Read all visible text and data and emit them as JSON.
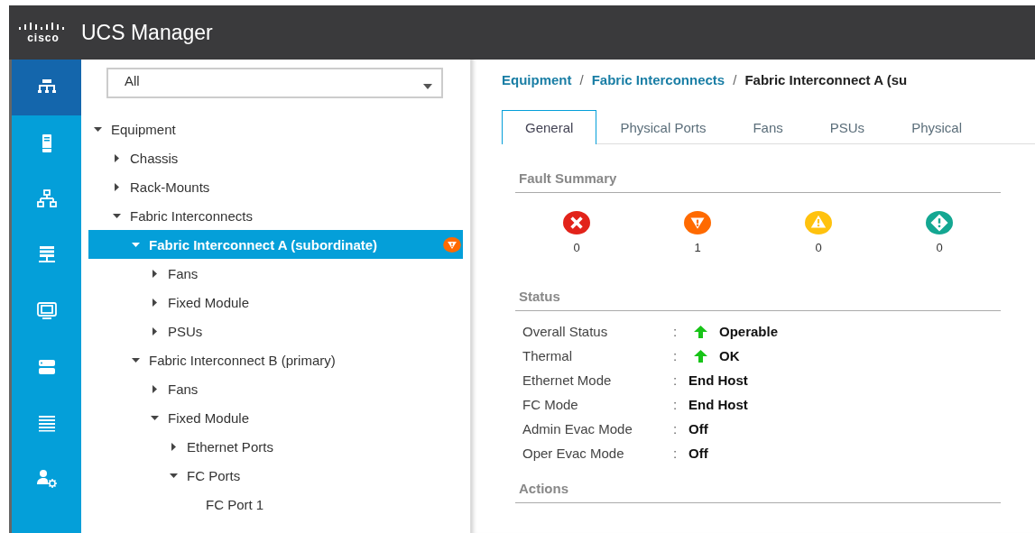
{
  "header": {
    "logo": "cisco",
    "title": "UCS Manager"
  },
  "nav": [
    {
      "kind": "hierarchy",
      "selected": true
    },
    {
      "kind": "server",
      "selected": false
    },
    {
      "kind": "network",
      "selected": false
    },
    {
      "kind": "stack",
      "selected": false
    },
    {
      "kind": "monitor",
      "selected": false
    },
    {
      "kind": "storage",
      "selected": false
    },
    {
      "kind": "list",
      "selected": false
    },
    {
      "kind": "admin",
      "selected": false
    }
  ],
  "filter": {
    "value": "All"
  },
  "tree": [
    {
      "label": "Equipment",
      "expanded": true,
      "selected": false,
      "children": [
        {
          "label": "Chassis",
          "expanded": false,
          "selected": false
        },
        {
          "label": "Rack-Mounts",
          "expanded": false,
          "selected": false
        },
        {
          "label": "Fabric Interconnects",
          "expanded": true,
          "selected": false,
          "children": [
            {
              "label": "Fabric Interconnect A (subordinate)",
              "expanded": true,
              "selected": true,
              "fault": {
                "kind": "major"
              },
              "children": [
                {
                  "label": "Fans",
                  "expanded": false,
                  "selected": false
                },
                {
                  "label": "Fixed Module",
                  "expanded": false,
                  "selected": false
                },
                {
                  "label": "PSUs",
                  "expanded": false,
                  "selected": false
                }
              ]
            },
            {
              "label": "Fabric Interconnect B (primary)",
              "expanded": true,
              "selected": false,
              "children": [
                {
                  "label": "Fans",
                  "expanded": false,
                  "selected": false
                },
                {
                  "label": "Fixed Module",
                  "expanded": true,
                  "selected": false,
                  "children": [
                    {
                      "label": "Ethernet Ports",
                      "expanded": false,
                      "selected": false
                    },
                    {
                      "label": "FC Ports",
                      "expanded": true,
                      "selected": false,
                      "children": [
                        {
                          "label": "FC Port 1",
                          "selected": false
                        }
                      ]
                    }
                  ]
                }
              ]
            }
          ]
        }
      ]
    }
  ],
  "breadcrumb": [
    {
      "label": "Equipment",
      "kind": "link"
    },
    {
      "label": "Fabric Interconnects",
      "kind": "link"
    },
    {
      "label": "Fabric Interconnect A (su",
      "kind": "current"
    }
  ],
  "breadcrumb_separator": "/",
  "tabs": [
    {
      "label": "General",
      "selected": true
    },
    {
      "label": "Physical Ports",
      "selected": false
    },
    {
      "label": "Fans",
      "selected": false
    },
    {
      "label": "PSUs",
      "selected": false
    },
    {
      "label": "Physical",
      "selected": false
    }
  ],
  "fault_summary": {
    "title": "Fault Summary",
    "items": [
      {
        "kind": "critical",
        "count": "0"
      },
      {
        "kind": "major",
        "count": "1"
      },
      {
        "kind": "minor",
        "count": "0"
      },
      {
        "kind": "warning",
        "count": "0"
      }
    ]
  },
  "status": {
    "title": "Status",
    "rows": [
      {
        "label": "Overall Status",
        "value": "Operable",
        "kind": "up"
      },
      {
        "label": "Thermal",
        "value": "OK",
        "kind": "up"
      },
      {
        "label": "Ethernet Mode",
        "value": "End Host",
        "kind": "plain"
      },
      {
        "label": "FC Mode",
        "value": "End Host",
        "kind": "plain"
      },
      {
        "label": "Admin Evac Mode",
        "value": "Off",
        "kind": "plain"
      },
      {
        "label": "Oper Evac Mode",
        "value": "Off",
        "kind": "plain"
      }
    ],
    "separator": ":"
  },
  "actions": {
    "title": "Actions"
  }
}
